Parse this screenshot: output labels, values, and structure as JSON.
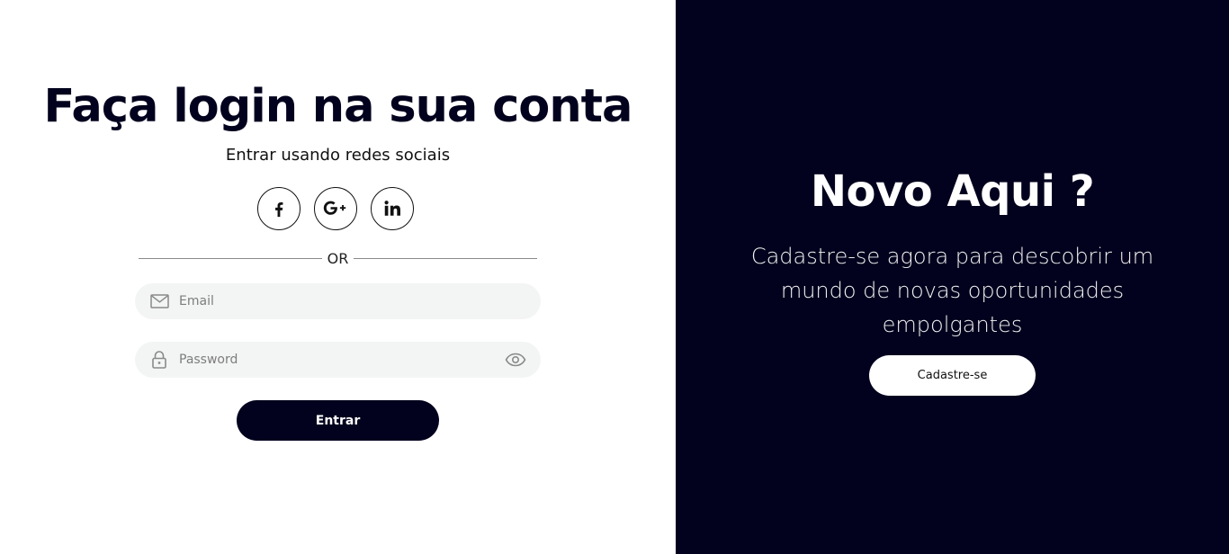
{
  "login": {
    "title": "Faça login na sua conta",
    "social_caption": "Entrar usando redes sociais",
    "social": [
      {
        "icon": "facebook-icon"
      },
      {
        "icon": "google-plus-icon"
      },
      {
        "icon": "linkedin-icon"
      }
    ],
    "divider_text": "OR",
    "email_placeholder": "Email",
    "password_placeholder": "Password",
    "submit_label": "Entrar"
  },
  "signup": {
    "title": "Novo Aqui ?",
    "text": "Cadastre-se agora para descobrir um mundo de novas oportunidades empolgantes",
    "button_label": "Cadastre-se"
  },
  "colors": {
    "dark": "#02021e",
    "light": "#ffffff",
    "field_bg": "#f3f5f4"
  }
}
